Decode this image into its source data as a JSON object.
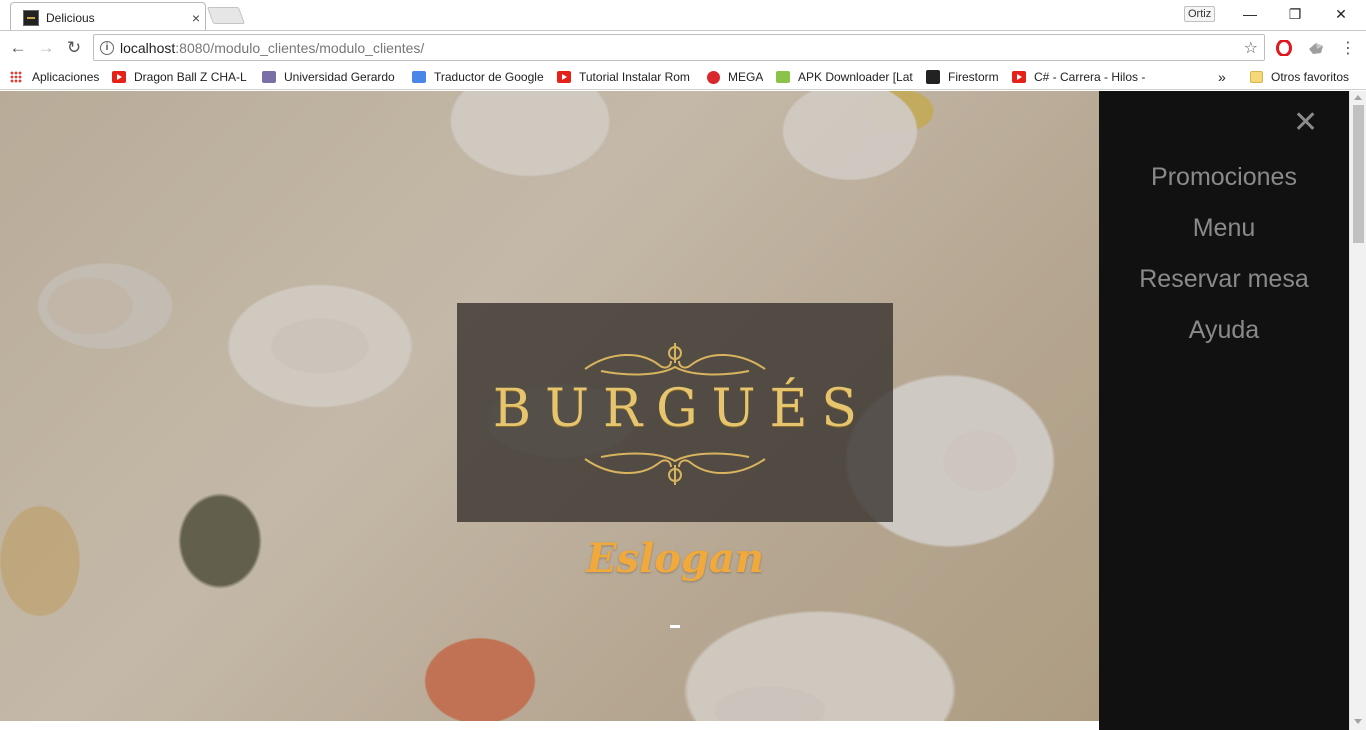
{
  "browser": {
    "tab_title": "Delicious",
    "tab_close": "×",
    "profile_name": "Ortiz",
    "window_controls": {
      "minimize": "—",
      "maximize": "❐",
      "close": "✕"
    },
    "nav": {
      "back": "←",
      "forward": "→",
      "reload": "↻"
    },
    "url_host": "localhost",
    "url_rest": ":8080/modulo_clientes/modulo_clientes/",
    "info_glyph": "i",
    "star_glyph": "☆",
    "bookmarks": [
      {
        "label": "Aplicaciones",
        "icon": "apps-grid-icon"
      },
      {
        "label": "Dragon Ball Z CHA-L",
        "icon": "youtube-icon"
      },
      {
        "label": "Universidad Gerardo",
        "icon": "university-icon"
      },
      {
        "label": "Traductor de Google",
        "icon": "google-translate-icon"
      },
      {
        "label": "Tutorial Instalar Rom",
        "icon": "youtube-icon"
      },
      {
        "label": "MEGA",
        "icon": "mega-icon"
      },
      {
        "label": "APK Downloader [Lat",
        "icon": "apk-icon"
      },
      {
        "label": "Firestorm",
        "icon": "firestorm-icon"
      },
      {
        "label": "C# - Carrera - Hilos -",
        "icon": "youtube-icon"
      }
    ],
    "bookmarks_overflow": "»",
    "other_bookmarks": "Otros favoritos",
    "colors": {
      "youtube": "#e62117",
      "mega": "#d9272e",
      "opera": "#e0171f"
    }
  },
  "page": {
    "logo_text": "BURGUÉS",
    "slogan": "Eslogan",
    "sidebar": {
      "close_glyph": "✕",
      "menu": [
        "Promociones",
        "Menu",
        "Reservar mesa",
        "Ayuda"
      ]
    },
    "colors": {
      "logo_gold": "#e6c56e",
      "slogan": "#f2a93b",
      "sidebar_bg": "#111111",
      "sidebar_text": "#8a8a8a"
    }
  }
}
